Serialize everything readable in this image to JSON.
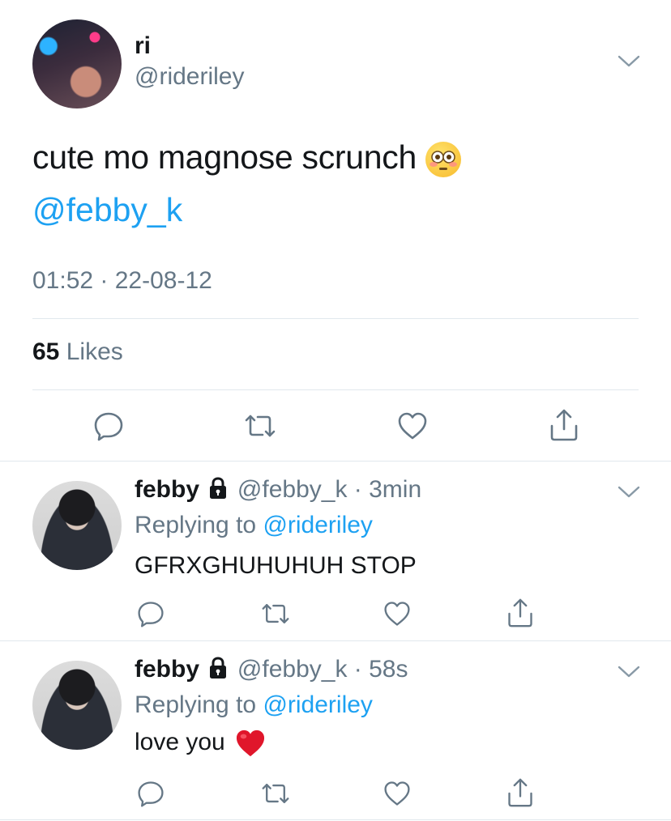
{
  "tweet": {
    "display_name": "ri",
    "handle": "@rideriley",
    "text": "cute mo magnose scrunch",
    "mention": "@febby_k",
    "timestamp": "01:52 · 22-08-12",
    "likes_count": "65",
    "likes_label": "Likes"
  },
  "replies": [
    {
      "display_name": "febby",
      "handle": "@febby_k",
      "time": "3min",
      "replying_prefix": "Replying to",
      "replying_to": "@rideriley",
      "text": "GFRXGHUHUHUH STOP"
    },
    {
      "display_name": "febby",
      "handle": "@febby_k",
      "time": "58s",
      "replying_prefix": "Replying to",
      "replying_to": "@rideriley",
      "text": "love you"
    }
  ],
  "icons": [
    "chevron-down-icon",
    "reply-icon",
    "retweet-icon",
    "like-icon",
    "share-icon",
    "lock-icon",
    "flushed-face-emoji",
    "red-heart-emoji"
  ],
  "colors": {
    "accent": "#1da1f2",
    "muted": "#657786",
    "text": "#14171a",
    "divider": "#e1e8ed"
  }
}
